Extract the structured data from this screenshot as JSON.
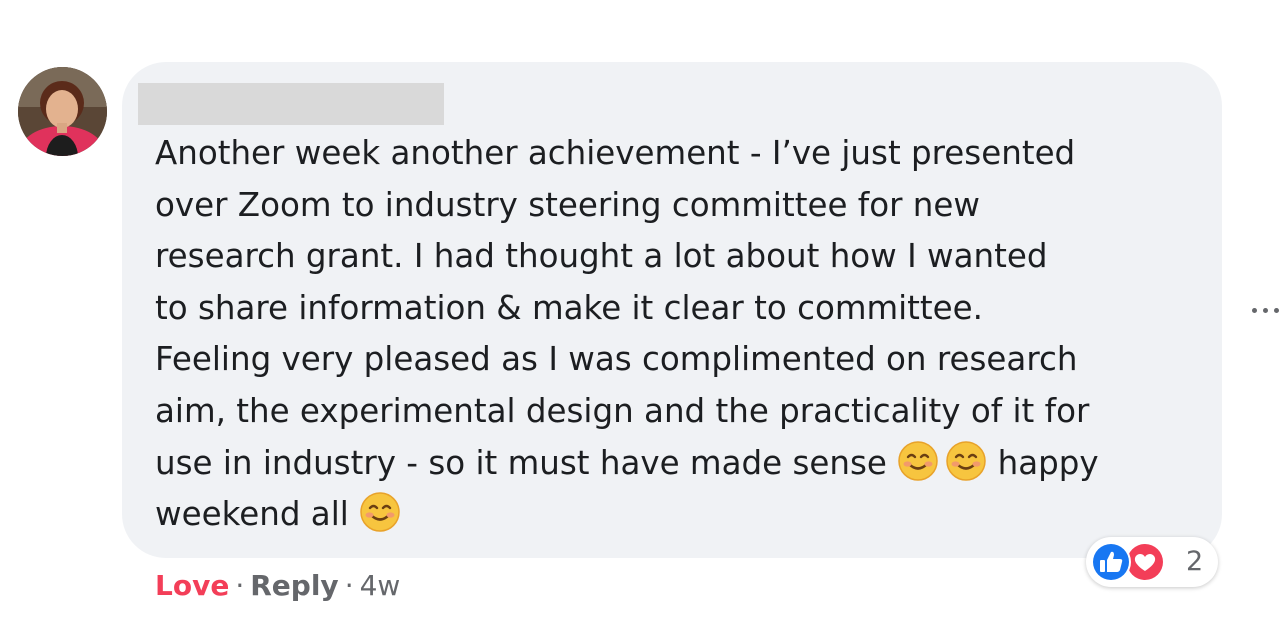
{
  "comment": {
    "lines": [
      "Another week another achievement - I’ve just presented",
      "over Zoom to industry steering committee for new",
      "research grant. I had thought a lot about how I wanted",
      "to share information & make it clear to committee.",
      "Feeling very pleased as I was complimented on research",
      "aim, the experimental design and the practicality of it for",
      "use in industry - so it must have made sense",
      "happy",
      "weekend all"
    ],
    "emoji": "smiling-face-with-smiling-eyes"
  },
  "reactions": {
    "count": "2",
    "icons": [
      "like-icon",
      "love-icon"
    ]
  },
  "actions": {
    "love_label": "Love",
    "reply_label": "Reply",
    "separator": "·",
    "timestamp": "4w"
  },
  "colors": {
    "bubble": "#f0f2f5",
    "love": "#f33e58",
    "like": "#1877f2",
    "muted": "#65676b"
  }
}
